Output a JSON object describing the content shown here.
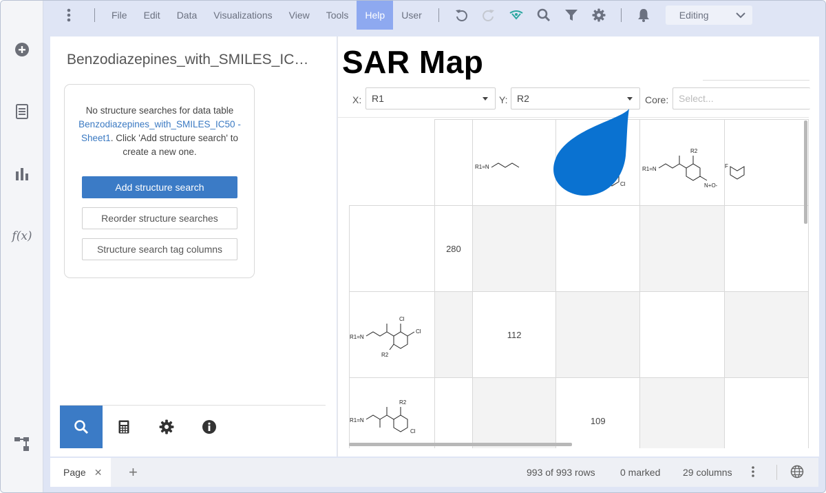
{
  "menu": {
    "items": [
      "File",
      "Edit",
      "Data",
      "Visualizations",
      "View",
      "Tools",
      "Help",
      "User"
    ],
    "active_item": "Help",
    "mode": "Editing"
  },
  "panel": {
    "title": "Benzodiazepines_with_SMILES_IC…",
    "message_before": "No structure searches for data table ",
    "message_link": "Benzodiazepines_with_SMILES_IC50 - Sheet1",
    "message_after": ". Click 'Add structure search' to create a new one.",
    "buttons": {
      "add": "Add structure search",
      "reorder": "Reorder structure searches",
      "tags": "Structure search tag columns"
    }
  },
  "viz": {
    "title": "SAR Map",
    "x_label": "X:",
    "x_value": "R1",
    "y_label": "Y:",
    "y_value": "R2",
    "core_label": "Core:",
    "core_placeholder": "Select..."
  },
  "chart_data": {
    "type": "table",
    "values": {
      "row1_col2": "280",
      "row2_col3": "112",
      "row3_col4": "109"
    },
    "structure_labels": {
      "r1n": "R1=N",
      "r2": "R2",
      "cl": "Cl",
      "f": "F",
      "no2": "N+O-"
    }
  },
  "status": {
    "page_tab": "Page",
    "rows": "993 of 993 rows",
    "marked": "0 marked",
    "columns": "29 columns"
  },
  "colors": {
    "accent": "#3b7bc6",
    "active_menu": "#8ea9f0",
    "drop_marker": "#0a72d1"
  }
}
